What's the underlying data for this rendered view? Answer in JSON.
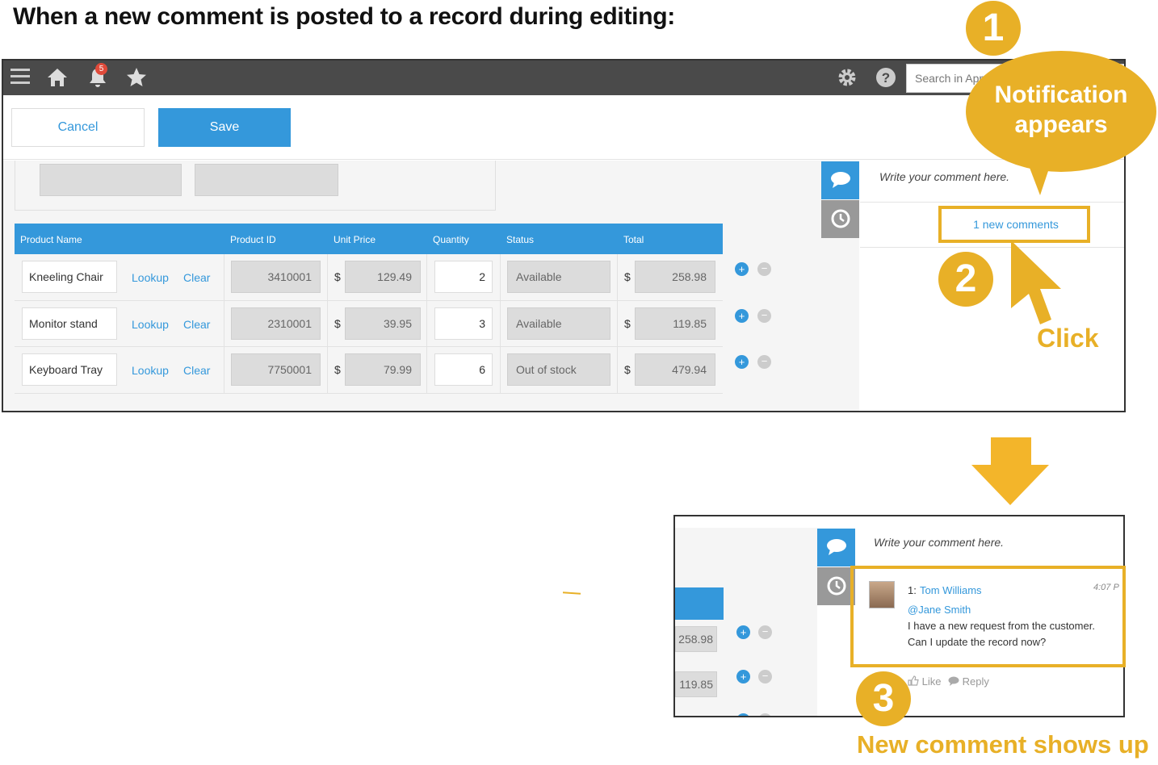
{
  "heading": "When a new comment is posted to a record during editing:",
  "topbar": {
    "menu_icon": "hamburger-icon",
    "home_icon": "home-icon",
    "notifications_count": "5",
    "favorites_icon": "star-icon",
    "settings_icon": "gear-icon",
    "help_icon": "help-icon",
    "search_placeholder": "Search in App"
  },
  "actions": {
    "cancel_label": "Cancel",
    "save_label": "Save"
  },
  "table": {
    "headers": [
      "Product Name",
      "Product ID",
      "Unit Price",
      "Quantity",
      "Status",
      "Total"
    ],
    "lookup_label": "Lookup",
    "clear_label": "Clear",
    "currency": "$",
    "rows": [
      {
        "name": "Kneeling Chair",
        "id": "3410001",
        "price": "129.49",
        "qty": "2",
        "status": "Available",
        "total": "258.98"
      },
      {
        "name": "Monitor stand",
        "id": "2310001",
        "price": "39.95",
        "qty": "3",
        "status": "Available",
        "total": "119.85"
      },
      {
        "name": "Keyboard Tray",
        "id": "7750001",
        "price": "79.99",
        "qty": "6",
        "status": "Out of stock",
        "total": "479.94"
      }
    ]
  },
  "comments": {
    "placeholder": "Write your comment here.",
    "new_comments_label": "1 new comments",
    "comment": {
      "index": "1:",
      "author": "Tom Williams",
      "time": "4:07 P",
      "mention": "@Jane Smith",
      "line1": "I have a new request from the customer.",
      "line2": "Can I update the record now?",
      "like_label": "Like",
      "reply_label": "Reply"
    }
  },
  "bottom_partial": {
    "total1": "258.98",
    "total2": "119.85"
  },
  "callouts": {
    "step1": "1",
    "notification_line1": "Notification",
    "notification_line2": "appears",
    "step2": "2",
    "click_label": "Click",
    "step3": "3",
    "new_comment_label": "New comment shows up"
  },
  "colors": {
    "accent": "#3498db",
    "callout": "#e8b027",
    "topbar": "#4a4a4a"
  }
}
